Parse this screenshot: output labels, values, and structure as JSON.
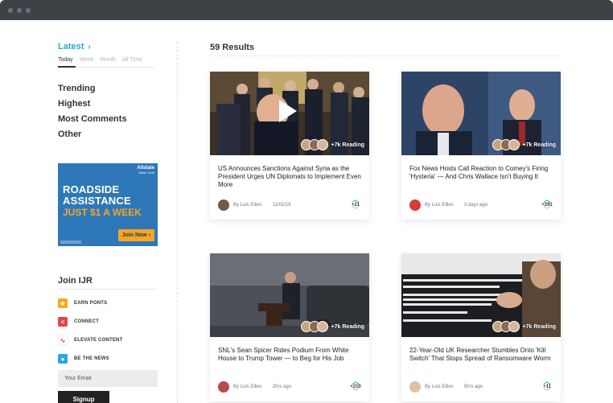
{
  "sidebar": {
    "latest_label": "Latest",
    "periods": [
      "Today",
      "Week",
      "Month",
      "All Time"
    ],
    "filters": [
      "Trending",
      "Highest",
      "Most Comments",
      "Other"
    ],
    "ad": {
      "brand": "Allstate",
      "brand_sub": "Motor Club",
      "headline_1": "ROADSIDE",
      "headline_2": "ASSISTANCE",
      "offer": "JUST $1 A WEEK",
      "cta": "Join Now ›"
    },
    "join": {
      "title": "Join IJR",
      "perks": [
        {
          "label": "EARN PONTS",
          "icon": "star-icon",
          "color": "#f6a623"
        },
        {
          "label": "CONNECT",
          "icon": "share-icon",
          "color": "#e8434a"
        },
        {
          "label": "ELEVATE CONTENT",
          "icon": "pulse-icon",
          "color": "#ffffff"
        },
        {
          "label": "BE THE NEWS",
          "icon": "person-icon",
          "color": "#2aa7de"
        }
      ],
      "email_placeholder": "Your Email",
      "signup_label": "Signup"
    }
  },
  "main": {
    "results_title": "59 Results",
    "cards": [
      {
        "headline": "US Announces Sanctions Against Syria as the President Urges UN Diplomats to Implement Even More",
        "author": "By Luis Ellies",
        "time": "11/02/16",
        "votes": "+21",
        "readers": "+7k Reading",
        "has_video": true
      },
      {
        "headline": "Fox News Hosts Call Reaction to Comey's Firing 'Hysteria' — And Chris Wallace Isn't Buying It",
        "author": "By Luis Ellies",
        "time": "3 days ago",
        "votes": "+291",
        "readers": "+7k Reading",
        "has_video": false
      },
      {
        "headline": "SNL's Sean Spicer Rides Podium From White House to Trump Tower — to Beg for His Job",
        "author": "By Luis Ellies",
        "time": "2hrs ago",
        "votes": "+210",
        "readers": "+7k Reading",
        "has_video": false
      },
      {
        "headline": "22-Year-Old UK Researcher Stumbles Onto 'Kill Switch' That Stops Spread of Ransomware Worm",
        "author": "By Luis Ellies",
        "time": "5hrs ago",
        "votes": "+11",
        "readers": "+7k Reading",
        "has_video": false
      }
    ]
  },
  "colors": {
    "accent": "#2aa7de",
    "titlebar": "#3d4246",
    "ad_bg": "#2e78b9",
    "ad_orange": "#f6a623"
  }
}
